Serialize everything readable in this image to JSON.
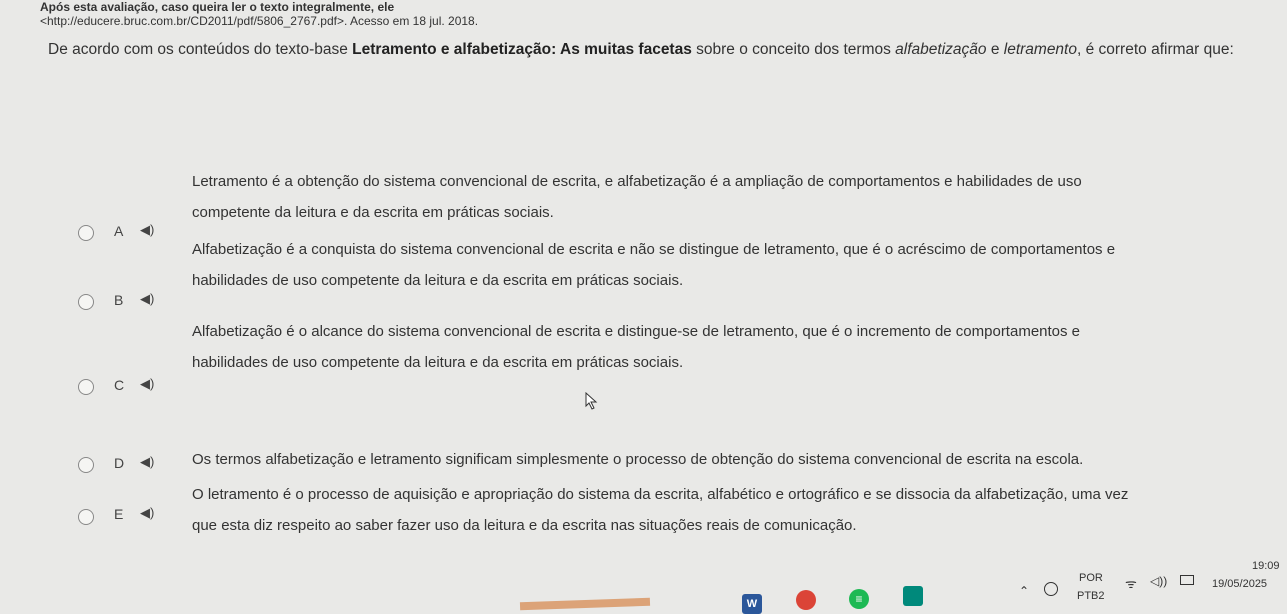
{
  "header": {
    "note": "Após esta avaliação, caso queira ler o texto integralmente, ele",
    "source": "<http://educere.bruc.com.br/CD2011/pdf/5806_2767.pdf>. Acesso em 18 jul. 2018."
  },
  "question": {
    "intro": "De acordo com os conteúdos do texto-base ",
    "title": "Letramento e alfabetização: As muitas facetas",
    "mid": " sobre o conceito dos termos ",
    "term1": "alfabetização",
    "conj": " e ",
    "term2": "letramento",
    "end": ", é correto afirmar que:"
  },
  "options": [
    {
      "letter": "A",
      "line1": "Letramento é a obtenção do sistema convencional de escrita, e alfabetização é a ampliação de comportamentos e habilidades de uso",
      "line2": "competente da leitura e da escrita em práticas sociais."
    },
    {
      "letter": "B",
      "line1": "Alfabetização é a conquista do sistema convencional de escrita e não se distingue de letramento, que é o acréscimo de comportamentos e",
      "line2": "habilidades de uso competente da leitura e da escrita em práticas sociais."
    },
    {
      "letter": "C",
      "line1": "Alfabetização é o alcance do sistema convencional de escrita e distingue-se de letramento, que é o incremento de comportamentos e",
      "line2": "habilidades de uso competente da leitura e da escrita em práticas sociais."
    },
    {
      "letter": "D",
      "line1": "Os termos alfabetização e letramento significam simplesmente o processo de obtenção do sistema convencional de escrita na escola.",
      "line2": ""
    },
    {
      "letter": "E",
      "line1": "O letramento é o processo de aquisição e apropriação do sistema da escrita, alfabético e ortográfico e se dissocia da alfabetização, uma vez",
      "line2": "que esta diz respeito ao saber fazer uso da leitura e da escrita nas situações reais de comunicação."
    }
  ],
  "taskbar": {
    "lang": "POR",
    "layout": "PTB2",
    "time": "19:09",
    "date": "19/05/2025",
    "icons": [
      "word-icon",
      "chrome-icon",
      "menu-app-icon",
      "image-app-icon"
    ],
    "colors": {
      "word": "#2b579a",
      "chrome": "#db4437",
      "green": "#1db954",
      "teal": "#00897b"
    }
  }
}
